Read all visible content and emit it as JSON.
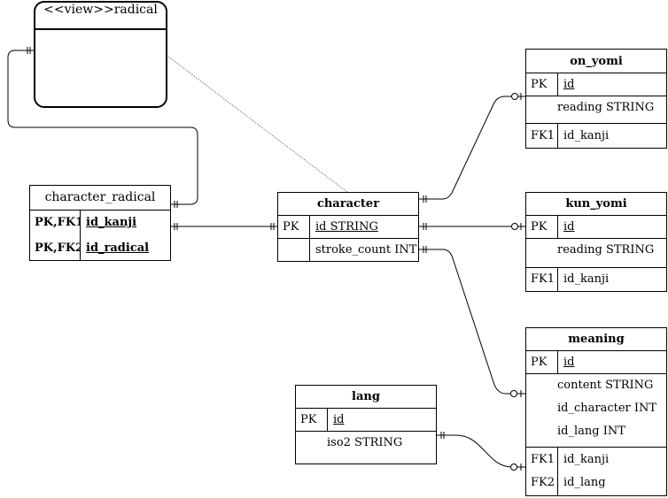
{
  "diagram": {
    "views": [
      {
        "name": "<<view>>radical"
      }
    ],
    "entities": {
      "character_radical": {
        "title": "character_radical",
        "rows": [
          {
            "key": "PK,FK1",
            "field": "id_kanji"
          },
          {
            "key": "PK,FK2",
            "field": "id_radical"
          }
        ]
      },
      "character": {
        "title": "character",
        "rows": [
          {
            "key": "PK",
            "field": "id STRING"
          },
          {
            "key": "",
            "field": "stroke_count INT"
          }
        ]
      },
      "on_yomi": {
        "title": "on_yomi",
        "pk": {
          "key": "PK",
          "field": "id"
        },
        "attrs": [
          "reading STRING"
        ],
        "fk": [
          {
            "key": "FK1",
            "field": "id_kanji"
          }
        ]
      },
      "kun_yomi": {
        "title": "kun_yomi",
        "pk": {
          "key": "PK",
          "field": "id"
        },
        "attrs": [
          "reading STRING"
        ],
        "fk": [
          {
            "key": "FK1",
            "field": "id_kanji"
          }
        ]
      },
      "meaning": {
        "title": "meaning",
        "pk": {
          "key": "PK",
          "field": "id"
        },
        "attrs": [
          "content STRING",
          "id_character INT",
          "id_lang INT"
        ],
        "fk": [
          {
            "key": "FK1",
            "field": "id_kanji"
          },
          {
            "key": "FK2",
            "field": "id_lang"
          }
        ]
      },
      "lang": {
        "title": "lang",
        "pk": {
          "key": "PK",
          "field": "id"
        },
        "attrs": [
          "iso2 STRING"
        ]
      }
    },
    "relationships": [
      {
        "from": "character_radical",
        "to": "radical",
        "from_card": "one-and-only-one",
        "to_card": "one-and-only-one"
      },
      {
        "from": "character_radical",
        "to": "character",
        "from_card": "one-and-only-one",
        "to_card": "one-and-only-one"
      },
      {
        "from": "character",
        "to": "on_yomi",
        "from_card": "one-and-only-one",
        "to_card": "zero-or-one"
      },
      {
        "from": "character",
        "to": "kun_yomi",
        "from_card": "one-and-only-one",
        "to_card": "zero-or-one"
      },
      {
        "from": "character",
        "to": "meaning",
        "from_card": "one-and-only-one",
        "to_card": "zero-or-one"
      },
      {
        "from": "lang",
        "to": "meaning",
        "from_card": "one-and-only-one",
        "to_card": "zero-or-one"
      },
      {
        "from": "radical",
        "to": "character",
        "style": "dotted"
      }
    ],
    "colors": {
      "line": "#000000",
      "dotted": "#777777",
      "background": "#ffffff"
    }
  }
}
